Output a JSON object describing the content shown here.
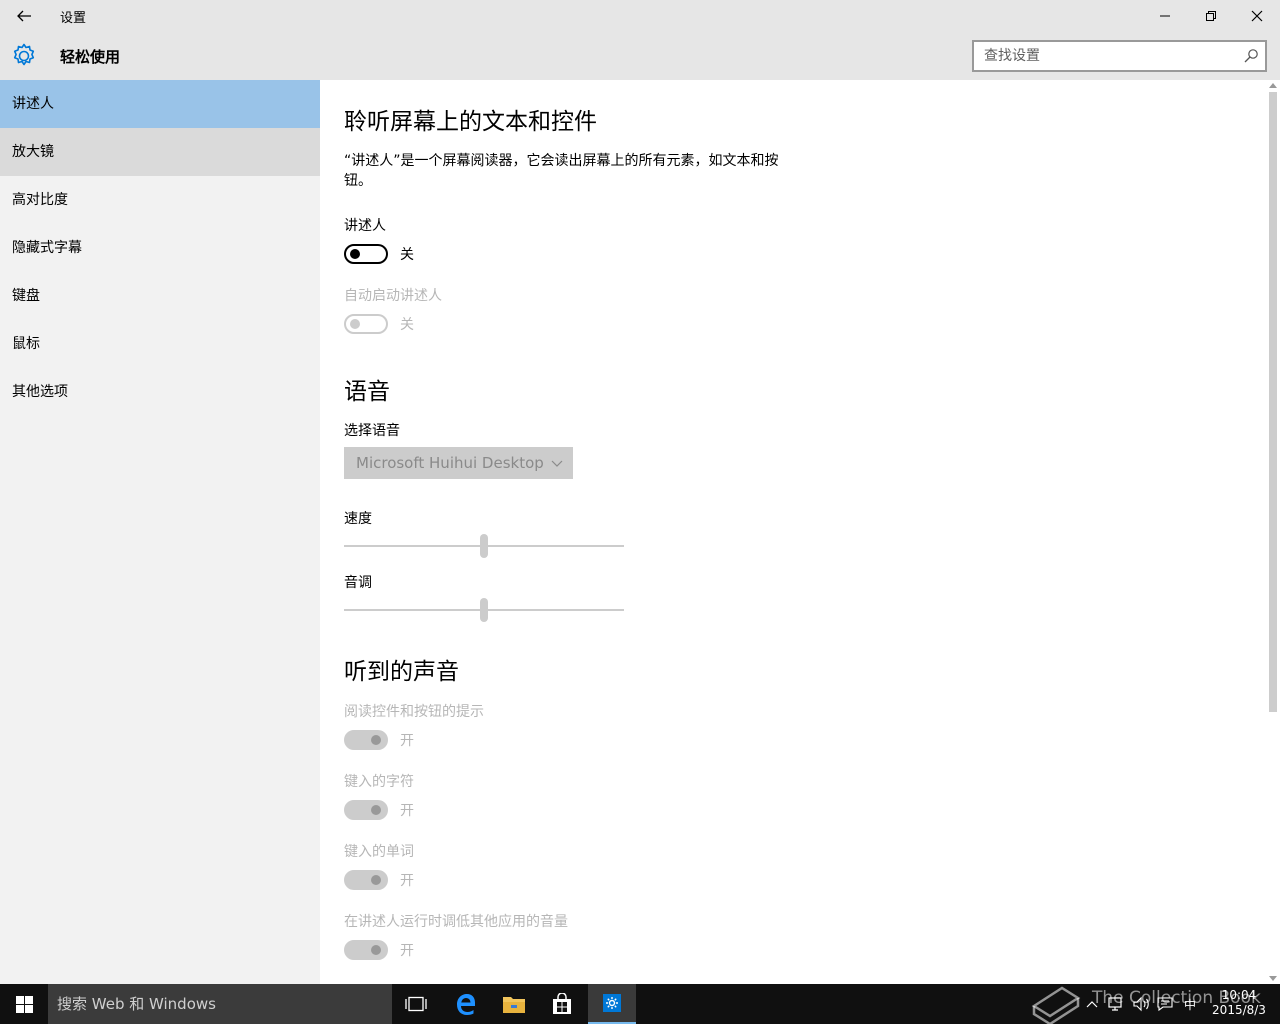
{
  "window": {
    "title": "设置",
    "header_title": "轻松使用",
    "search_placeholder": "查找设置"
  },
  "sidebar": {
    "items": [
      {
        "label": "讲述人",
        "state": "selected"
      },
      {
        "label": "放大镜",
        "state": "hover"
      },
      {
        "label": "高对比度",
        "state": "normal"
      },
      {
        "label": "隐藏式字幕",
        "state": "normal"
      },
      {
        "label": "键盘",
        "state": "normal"
      },
      {
        "label": "鼠标",
        "state": "normal"
      },
      {
        "label": "其他选项",
        "state": "normal"
      }
    ]
  },
  "content": {
    "section1_title": "聆听屏幕上的文本和控件",
    "description": "“讲述人”是一个屏幕阅读器，它会读出屏幕上的所有元素，如文本和按钮。",
    "narrator_label": "讲述人",
    "narrator_state": "关",
    "autostart_label": "自动启动讲述人",
    "autostart_state": "关",
    "section2_title": "语音",
    "voice_label": "选择语音",
    "voice_value": "Microsoft Huihui Desktop",
    "speed_label": "速度",
    "speed_value": 0.5,
    "pitch_label": "音调",
    "pitch_value": 0.5,
    "section3_title": "听到的声音",
    "sound_options": [
      {
        "label": "阅读控件和按钮的提示",
        "state": "开"
      },
      {
        "label": "键入的字符",
        "state": "开"
      },
      {
        "label": "键入的单词",
        "state": "开"
      },
      {
        "label": "在讲述人运行时调低其他应用的音量",
        "state": "开"
      }
    ]
  },
  "taskbar": {
    "search_text": "搜索 Web 和 Windows",
    "time": "10:04",
    "date": "2015/8/3",
    "ime": "中",
    "watermark": "The Collection Book"
  },
  "colors": {
    "accent": "#0078d7",
    "selected_bg": "#99c3e8",
    "chrome_bg": "#e6e6e6",
    "sidebar_bg": "#f2f2f2",
    "taskbar_bg": "#101010"
  }
}
